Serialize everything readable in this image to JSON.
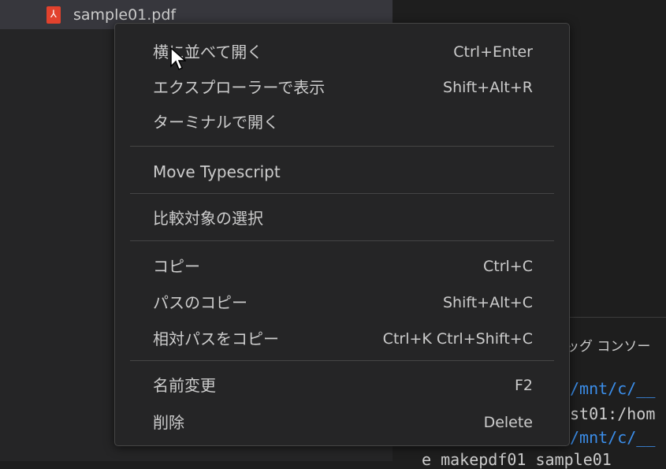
{
  "explorer": {
    "file_name": "sample01.pdf",
    "file_icon": "pdf-icon"
  },
  "panel": {
    "tab_label": "ッグ コンソー",
    "terminal_lines": [
      "/mnt/c/__",
      "st01:/hom",
      "/mnt/c/__",
      "e makepdf01 sample01"
    ]
  },
  "context_menu": {
    "groups": [
      [
        {
          "label": "横に並べて開く",
          "shortcut": "Ctrl+Enter"
        },
        {
          "label": "エクスプローラーで表示",
          "shortcut": "Shift+Alt+R"
        },
        {
          "label": "ターミナルで開く",
          "shortcut": ""
        }
      ],
      [
        {
          "label": "Move Typescript",
          "shortcut": ""
        }
      ],
      [
        {
          "label": "比較対象の選択",
          "shortcut": ""
        }
      ],
      [
        {
          "label": "コピー",
          "shortcut": "Ctrl+C"
        },
        {
          "label": "パスのコピー",
          "shortcut": "Shift+Alt+C"
        },
        {
          "label": "相対パスをコピー",
          "shortcut": "Ctrl+K Ctrl+Shift+C"
        }
      ],
      [
        {
          "label": "名前変更",
          "shortcut": "F2"
        },
        {
          "label": "削除",
          "shortcut": "Delete"
        }
      ]
    ]
  },
  "colors": {
    "menu_bg": "#252526",
    "pdf_icon": "#e2422d",
    "terminal_path": "#3b8eea"
  }
}
